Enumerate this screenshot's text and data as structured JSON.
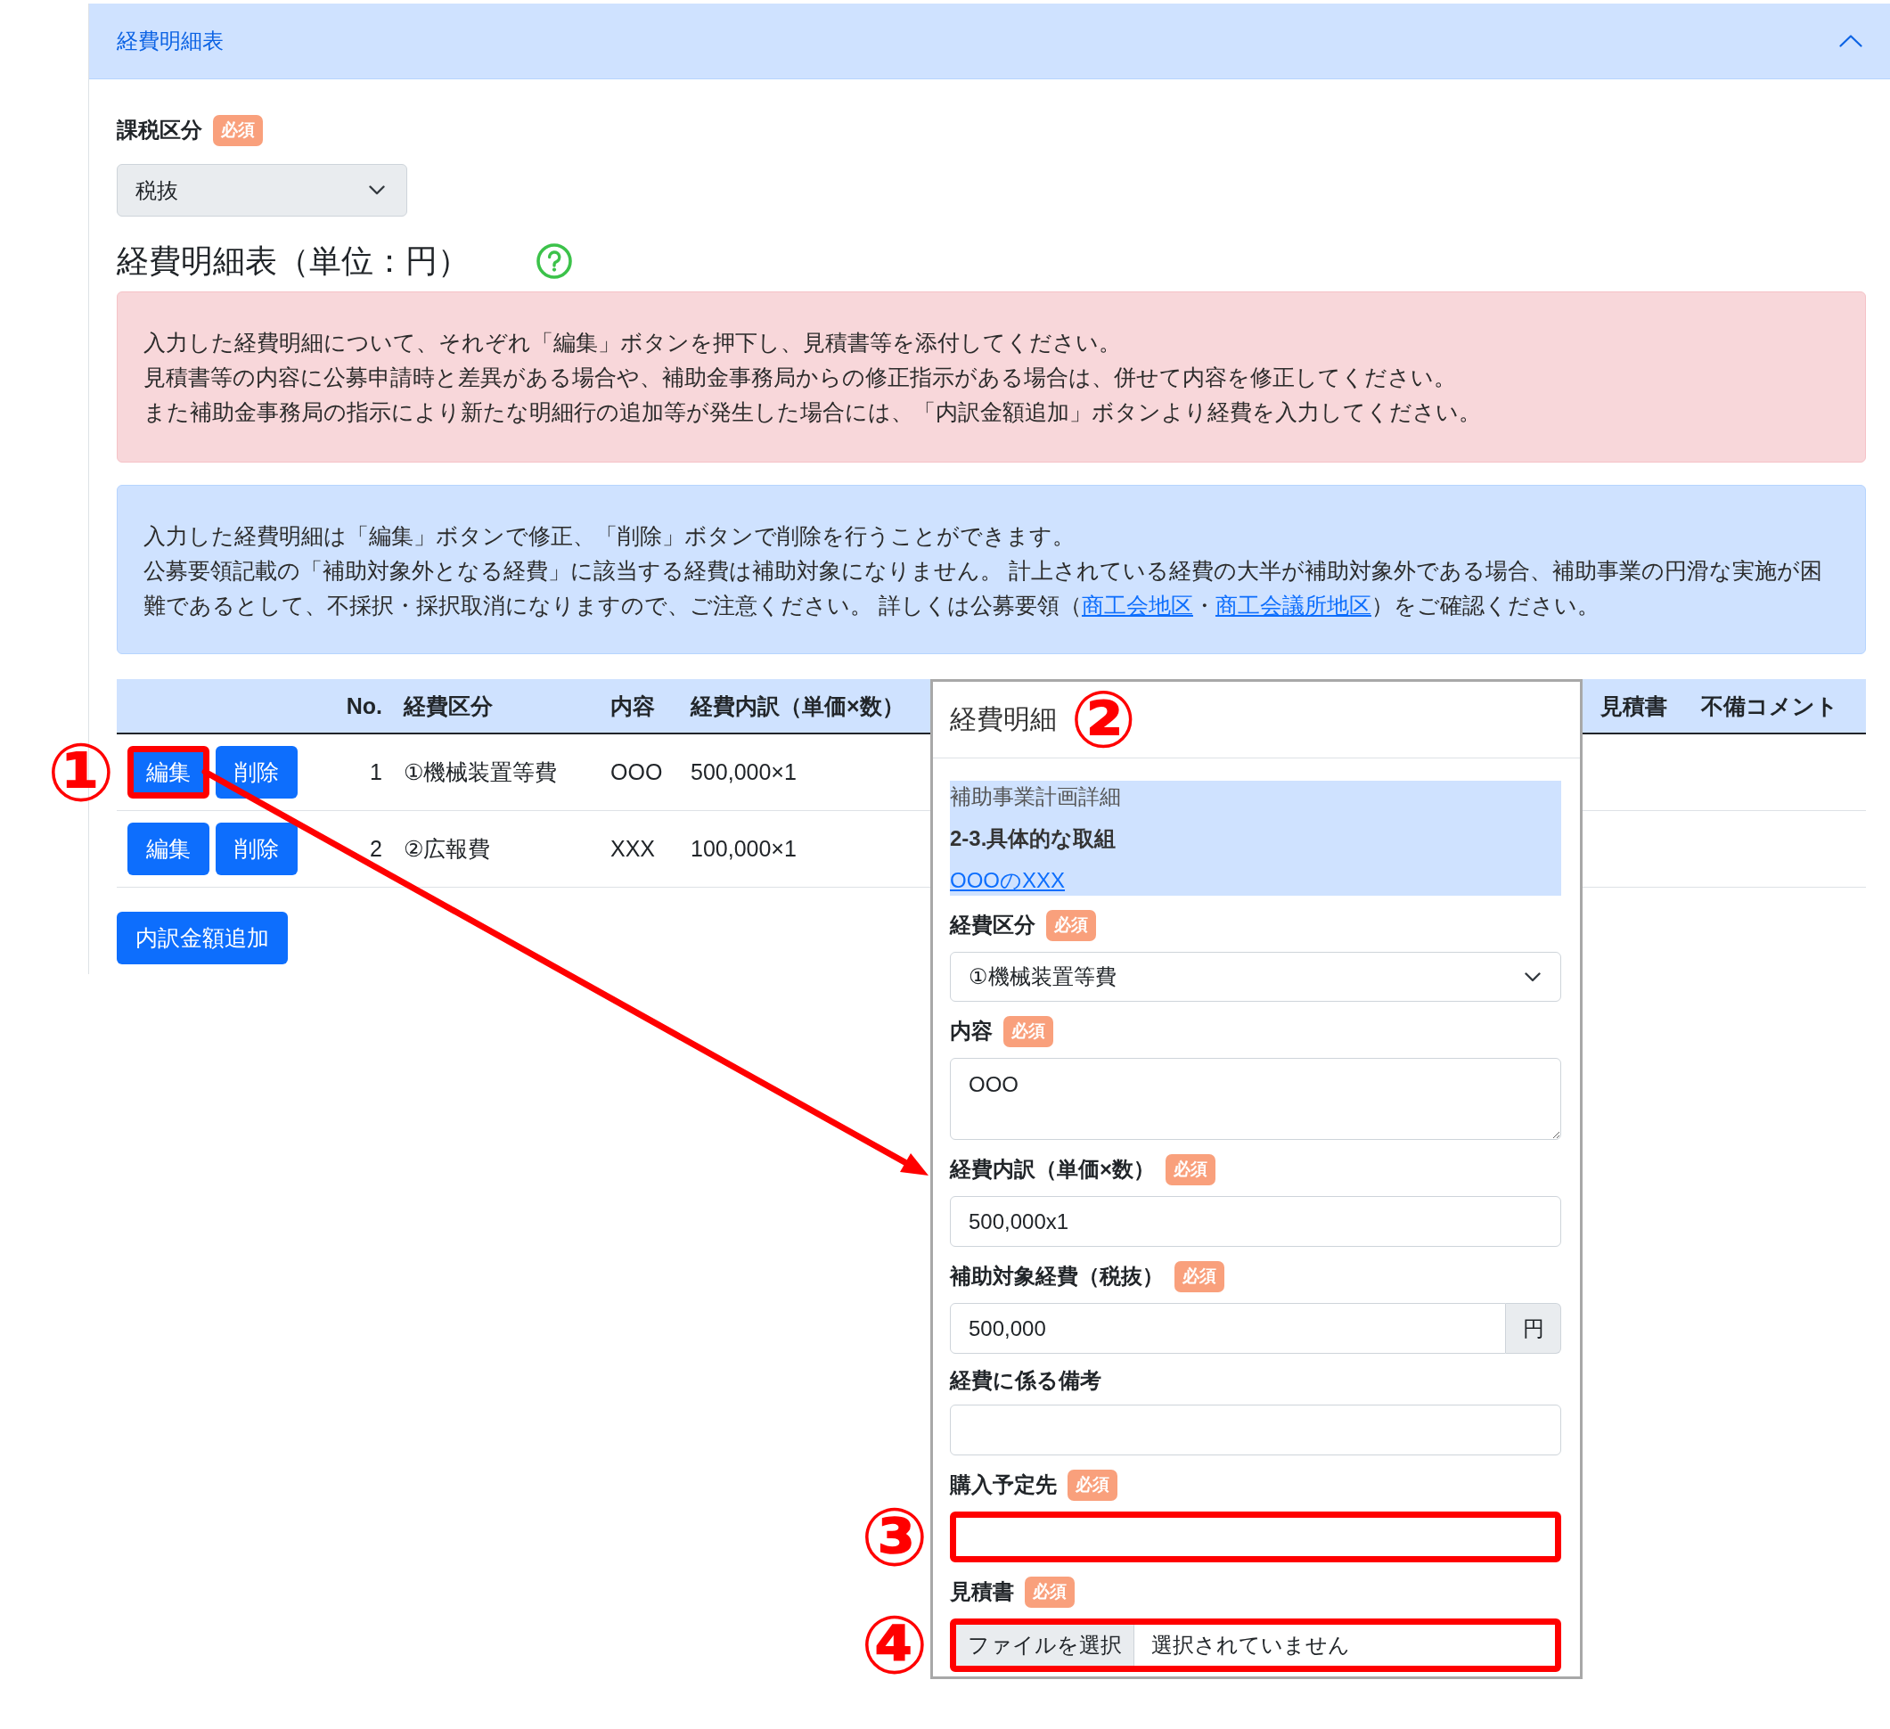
{
  "accordion": {
    "title": "経費明細表",
    "expanded": true
  },
  "tax_field": {
    "label": "課税区分",
    "badge": "必須",
    "value": "税抜"
  },
  "section": {
    "title": "経費明細表（単位：円）"
  },
  "alerts": [
    {
      "kind": "danger",
      "lines": [
        {
          "segments": [
            {
              "kind": "text",
              "text": "入力した経費明細について、それぞれ「編集」ボタンを押下し、見積書等を添付してください。"
            }
          ]
        },
        {
          "segments": [
            {
              "kind": "text",
              "text": "見積書等の内容に公募申請時と差異がある場合や、補助金事務局からの修正指示がある場合は、併せて内容を修正してください。"
            }
          ]
        },
        {
          "segments": [
            {
              "kind": "text",
              "text": "また補助金事務局の指示により新たな明細行の追加等が発生した場合には、「内訳金額追加」ボタンより経費を入力してください。"
            }
          ]
        }
      ]
    },
    {
      "kind": "info",
      "lines": [
        {
          "segments": [
            {
              "kind": "text",
              "text": "入力した経費明細は「編集」ボタンで修正、「削除」ボタンで削除を行うことができます。"
            }
          ]
        },
        {
          "segments": [
            {
              "kind": "text",
              "text": "公募要領記載の「補助対象外となる経費」に該当する経費は補助対象になりません。 計上されている経費の大半が補助対象外である場合、補助事業の円滑な実施が困難であるとして、不採択・採択取消になりますので、ご注意ください。 詳しくは公募要領（"
            },
            {
              "kind": "link",
              "text": "商工会地区"
            },
            {
              "kind": "text",
              "text": "・"
            },
            {
              "kind": "link",
              "text": "商工会議所地区"
            },
            {
              "kind": "text",
              "text": "）をご確認ください。"
            }
          ]
        }
      ]
    }
  ],
  "table": {
    "columns": [
      "No.",
      "経費区分",
      "内容",
      "経費内訳（単価×数）",
      "見積書",
      "不備コメント"
    ],
    "rows": [
      {
        "no": "1",
        "category": "①機械装置等費",
        "content": "OOO",
        "breakdown": "500,000×1",
        "edit_button": {
          "label": "編集",
          "highlighted": true,
          "marker": "①"
        },
        "delete_button": {
          "label": "削除",
          "highlighted": false
        }
      },
      {
        "no": "2",
        "category": "②広報費",
        "content": "XXX",
        "breakdown": "100,000×1",
        "edit_button": {
          "label": "編集",
          "highlighted": false
        },
        "delete_button": {
          "label": "削除",
          "highlighted": false
        }
      }
    ]
  },
  "add_button": {
    "label": "内訳金額追加"
  },
  "dialog": {
    "title": "経費明細",
    "marker": "②",
    "plan": {
      "caption": "補助事業計画詳細",
      "heading": "2-3.具体的な取組",
      "link": "OOOのXXX"
    },
    "fields": [
      {
        "kind": "select",
        "label": "経費区分",
        "badge": "必須",
        "value": "①機械装置等費",
        "highlighted": false
      },
      {
        "kind": "textarea",
        "label": "内容",
        "badge": "必須",
        "value": "OOO",
        "highlighted": false
      },
      {
        "kind": "text",
        "label": "経費内訳（単価×数）",
        "badge": "必須",
        "value": "500,000x1",
        "highlighted": false
      },
      {
        "kind": "addon",
        "label": "補助対象経費（税抜）",
        "badge": "必須",
        "value": "500,000",
        "addon": "円",
        "highlighted": false
      },
      {
        "kind": "text",
        "label": "経費に係る備考",
        "highlighted": false
      },
      {
        "kind": "text",
        "label": "購入予定先",
        "badge": "必須",
        "highlighted": true,
        "marker": "③"
      },
      {
        "kind": "file",
        "label": "見積書",
        "badge": "必須",
        "button": "ファイルを選択",
        "status": "選択されていません",
        "highlighted": true,
        "marker": "④"
      }
    ]
  }
}
